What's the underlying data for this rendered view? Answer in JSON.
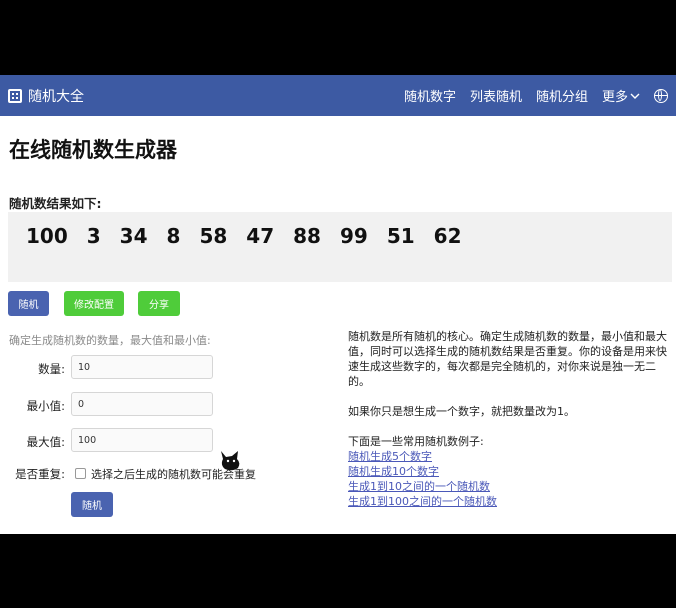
{
  "nav": {
    "brand": "随机大全",
    "links": [
      "随机数字",
      "列表随机",
      "随机分组"
    ],
    "more": "更多"
  },
  "page_title": "在线随机数生成器",
  "result": {
    "label": "随机数结果如下:",
    "numbers": [
      "100",
      "3",
      "34",
      "8",
      "58",
      "47",
      "88",
      "99",
      "51",
      "62"
    ]
  },
  "actions": {
    "random": "随机",
    "modify_config": "修改配置",
    "share": "分享"
  },
  "form": {
    "description": "确定生成随机数的数量，最大值和最小值:",
    "count_label": "数量:",
    "count_value": "10",
    "min_label": "最小值:",
    "min_value": "0",
    "max_label": "最大值:",
    "max_value": "100",
    "repeat_label": "是否重复:",
    "repeat_text": "选择之后生成的随机数可能会重复",
    "repeat_checked": false,
    "submit": "随机"
  },
  "info": {
    "paragraph1": "随机数是所有随机的核心。确定生成随机数的数量，最小值和最大值，同时可以选择生成的随机数结果是否重复。你的设备是用来快速生成这些数字的，每次都是完全随机的，对你来说是独一无二的。",
    "paragraph2": "如果你只是想生成一个数字，就把数量改为1。",
    "examples_intro": "下面是一些常用随机数例子:",
    "examples": [
      "随机生成5个数字",
      "随机生成10个数字",
      "生成1到10之间的一个随机数",
      "生成1到100之间的一个随机数"
    ]
  },
  "colors": {
    "navbar": "#3d5aa3",
    "primary_button": "#4a63b0",
    "success_button": "#4fcc3a",
    "link": "#4a58b8"
  }
}
